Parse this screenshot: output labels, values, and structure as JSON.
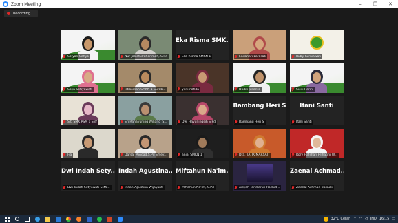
{
  "window": {
    "title": "Zoom Meeting",
    "controls": [
      "–",
      "❐",
      "✕"
    ]
  },
  "recording": {
    "label": "Recording..."
  },
  "participants": [
    {
      "name": "Sofyan Cahyo",
      "video": true,
      "muted": true
    },
    {
      "name": "Nur Jalilatul Chorimah, S.Pd",
      "video": true,
      "muted": true
    },
    {
      "name": "Eka Risma SMKN 1",
      "big_name": "Eka Risma SMK...",
      "video": false,
      "muted": true
    },
    {
      "name": "Endahari Larasati",
      "video": true,
      "muted": true,
      "active": true
    },
    {
      "name": "Ruby Kurniawati",
      "video": true,
      "muted": true
    },
    {
      "name": "Saya Setiyawati",
      "video": true,
      "muted": true
    },
    {
      "name": "Istikomah SMKN 1 Surab...",
      "video": true,
      "muted": true
    },
    {
      "name": "yeni nafida",
      "video": true,
      "muted": true
    },
    {
      "name": "Dodik Julianto",
      "video": true,
      "muted": true
    },
    {
      "name": "Siesi Harini",
      "video": true,
      "muted": true
    },
    {
      "name": "Siti SMK PSM 1 SBY",
      "video": true,
      "muted": true
    },
    {
      "name": "Sri Rahayuning Wiljang_S...",
      "video": true,
      "muted": true
    },
    {
      "name": "Dwi Hayuningsih S.Pd",
      "video": true,
      "muted": true
    },
    {
      "name": "Bambang Heri S",
      "big_name": "Bambang Heri S",
      "video": false,
      "muted": true
    },
    {
      "name": "Ifani Santi",
      "big_name": "Ifani Santi",
      "video": false,
      "muted": true
    },
    {
      "name": "Fia",
      "video": true,
      "muted": true
    },
    {
      "name": "Darsal Miqdad,S.Pd Smek...",
      "video": true,
      "muted": true
    },
    {
      "name": "anjal SMKN 1",
      "video": true,
      "muted": true
    },
    {
      "name": "Dra. TATIK MARSATI",
      "video": true,
      "muted": true
    },
    {
      "name": "Rory Hafshari Prihatini W...",
      "video": true,
      "muted": true
    },
    {
      "name": "Dwi Indah Setyowati SMK...",
      "big_name": "Dwi Indah Sety...",
      "video": false,
      "muted": true
    },
    {
      "name": "Indah Agustina Wijayanti",
      "big_name": "Indah Agustina...",
      "video": false,
      "muted": true
    },
    {
      "name": "Miftahun Na'im, S.Pd",
      "big_name": "Miftahun Na'im...",
      "video": false,
      "muted": true
    },
    {
      "name": "Aisyah Tandiarun Rachid...",
      "video": true,
      "muted": true
    },
    {
      "name": "Zaenal Achmad Baisuki",
      "big_name": "Zaenal Achmad...",
      "video": false,
      "muted": true
    }
  ],
  "taskbar": {
    "weather": "32°C  Cerah",
    "lang": "IND",
    "time": "16:15"
  },
  "colors": {
    "active_outline": "#c8e03c",
    "muted_mic": "#e02828",
    "banner_green": "#3a8a2f",
    "taskbar": "#1c2a3c"
  }
}
